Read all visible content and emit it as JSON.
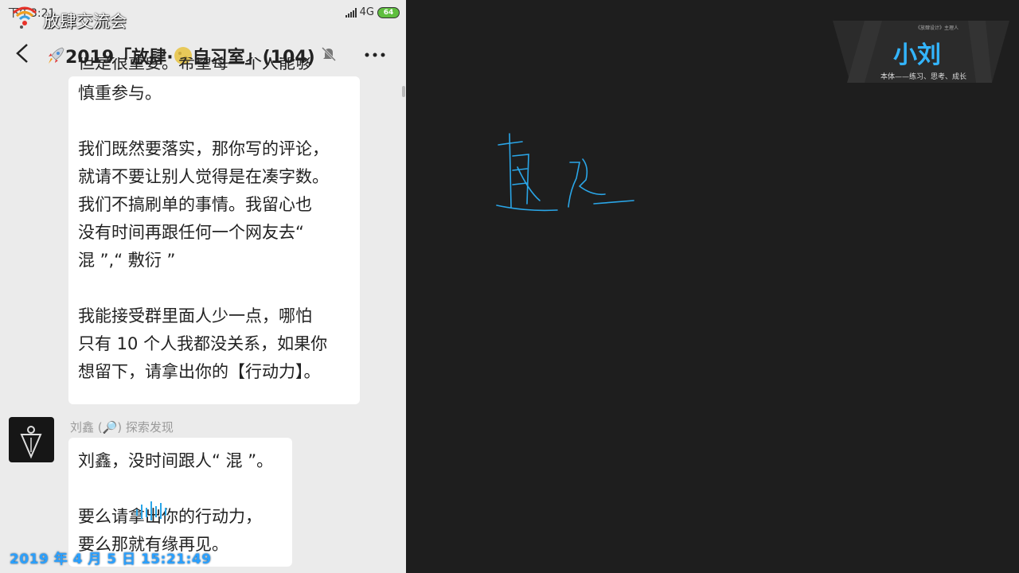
{
  "status_bar": {
    "time": "下午3:21",
    "network": "4G",
    "battery": "64"
  },
  "watermark": {
    "title": "放肆交流会",
    "datetime": "2019 年 4 月 5 日 15:21:49"
  },
  "chat": {
    "title": "🚀2019「放肆·🌕自习室」(104)",
    "title_text": "2019「放肆·",
    "title_text2": "自习室」(104)",
    "muted": true
  },
  "message1": {
    "partial_line": "但是很重要。希望每一个人能够",
    "lines": [
      "慎重参与。",
      "",
      "我们既然要落实，那你写的评论，",
      "就请不要让别人觉得是在凑字数。",
      "我们不搞刷单的事情。我留心也",
      "没有时间再跟任何一个网友去“",
      "混 ”,“ 敷衍 ”",
      "",
      "我能接受群里面人少一点，哪怕",
      "只有 10 个人我都没关系，如果你",
      "想留下，请拿出你的【行动力】。"
    ]
  },
  "message2": {
    "sender": "刘鑫 (🔎) 探索发现",
    "lines": [
      "刘鑫，没时间跟人“ 混 ”。",
      "",
      "要么请拿出你的行动力，",
      "要么那就有缘再见。"
    ]
  },
  "right_panel": {
    "logo_name": "小刘",
    "logo_top": "《放肆设计》主理人",
    "logo_sub": "本体——练习、思考、成长",
    "handwriting_color": "#2aa6e8"
  }
}
